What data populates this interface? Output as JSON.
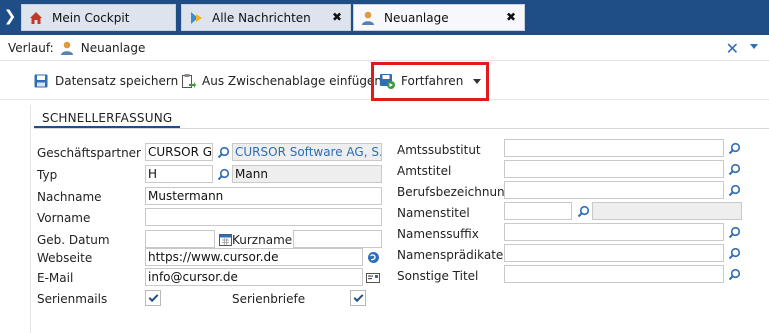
{
  "tabs": [
    {
      "label": "Mein Cockpit",
      "icon": "home-icon"
    },
    {
      "label": "Alle Nachrichten",
      "icon": "messages-icon",
      "close": "✖"
    },
    {
      "label": "Neuanlage",
      "icon": "person-icon",
      "close": "✖"
    }
  ],
  "verlauf": {
    "label": "Verlauf:",
    "item": "Neuanlage",
    "close": "✕"
  },
  "toolbar": {
    "save": "Datensatz speichern",
    "paste": "Aus Zwischenablage einfügen",
    "continue": "Fortfahren"
  },
  "section_tab": "SCHNELLERFASSUNG",
  "form_left": {
    "geschaeftspartner_label": "Geschäftspartner",
    "geschaeftspartner_value": "CURSOR GI",
    "geschaeftspartner_name": "CURSOR Software AG, S...",
    "typ_label": "Typ",
    "typ_value": "H",
    "typ_desc": "Mann",
    "nachname_label": "Nachname",
    "nachname_value": "Mustermann",
    "vorname_label": "Vorname",
    "vorname_value": "",
    "gebdatum_label": "Geb. Datum",
    "gebdatum_value": "",
    "kurzname_label": "Kurzname",
    "kurzname_value": "",
    "webseite_label": "Webseite",
    "webseite_value": "https://www.cursor.de",
    "email_label": "E-Mail",
    "email_value": "info@cursor.de",
    "serienmails_label": "Serienmails",
    "serienmails_checked": true,
    "serienbriefe_label": "Serienbriefe",
    "serienbriefe_checked": true
  },
  "form_right": {
    "amtssubstitut_label": "Amtssubstitut",
    "amtstitel_label": "Amtstitel",
    "berufsbezeichnung_label": "Berufsbezeichnung",
    "namenstitel_label": "Namenstitel",
    "namenssuffix_label": "Namenssuffix",
    "namenspraedikate_label": "Namensprädikate",
    "sonstige_titel_label": "Sonstige Titel"
  },
  "colors": {
    "tabbar": "#1f4e86",
    "accent": "#2a6ebb",
    "highlight": "#e01b1b"
  }
}
